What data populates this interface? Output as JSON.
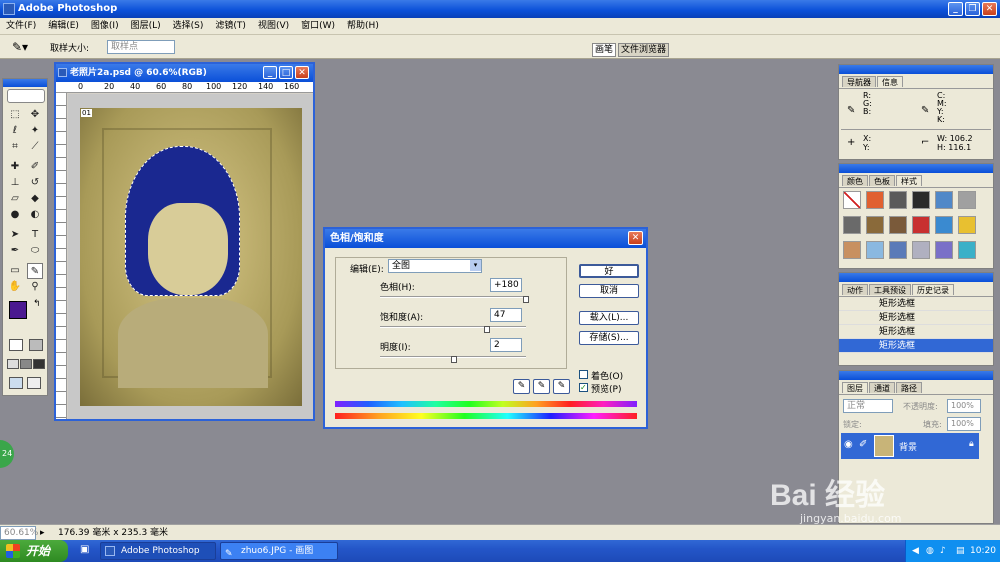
{
  "app": {
    "title": "Adobe Photoshop"
  },
  "menu": [
    "文件(F)",
    "编辑(E)",
    "图像(I)",
    "图层(L)",
    "选择(S)",
    "滤镜(T)",
    "视图(V)",
    "窗口(W)",
    "帮助(H)"
  ],
  "options": {
    "sample_size_label": "取样大小:",
    "sample_size_value": "取样点",
    "tabs": [
      "画笔",
      "文件浏览器"
    ]
  },
  "document": {
    "title": "老照片2a.psd @ 60.6%(RGB)",
    "ruler_ticks": [
      "0",
      "20",
      "40",
      "60",
      "80",
      "100",
      "120",
      "140",
      "160"
    ],
    "badge": "01"
  },
  "dialog": {
    "title": "色相/饱和度",
    "edit_label": "编辑(E):",
    "edit_value": "全图",
    "hue_label": "色相(H):",
    "hue_value": "+180",
    "saturation_label": "饱和度(A):",
    "saturation_value": "47",
    "lightness_label": "明度(I):",
    "lightness_value": "2",
    "hue_pos": 1.0,
    "saturation_pos": 0.735,
    "lightness_pos": 0.51,
    "ok": "好",
    "cancel": "取消",
    "load": "载入(L)...",
    "save": "存储(S)...",
    "colorize": "着色(O)",
    "preview": "预览(P)",
    "colorize_checked": false,
    "preview_checked": true
  },
  "navigator": {
    "tabs": [
      "导航器",
      "信息"
    ],
    "rgb_labels": [
      "R:",
      "G:",
      "B:"
    ],
    "cmyk_labels": [
      "C:",
      "M:",
      "Y:",
      "K:"
    ],
    "x_label": "X:",
    "y_label": "Y:",
    "w_label": "W:",
    "h_label": "H:",
    "w_value": "106.2",
    "h_value": "116.1"
  },
  "swatches": {
    "tabs": [
      "颜色",
      "色板",
      "样式"
    ],
    "colors": [
      "#ffffff",
      "#e06030",
      "#5a5a5a",
      "#2a2a2a",
      "#5088c8",
      "#a0a0a0",
      "#6a6a6a",
      "#8a6a3a",
      "#7a5a3a",
      "#c83030",
      "#3a8ad0",
      "#e8c030",
      "#c89060",
      "#8ab8e0",
      "#5a7ab8",
      "#b0b0c0",
      "#7a70c8",
      "#3ab0c8"
    ]
  },
  "history": {
    "tabs": [
      "动作",
      "工具预设",
      "历史记录"
    ],
    "items": [
      "矩形选框",
      "矩形选框",
      "矩形选框",
      "矩形选框"
    ]
  },
  "layers": {
    "tabs": [
      "图层",
      "通道",
      "路径"
    ],
    "blend_mode": "正常",
    "opacity_label": "不透明度:",
    "opacity_value": "100%",
    "lock_label": "锁定:",
    "fill_label": "填充:",
    "fill_value": "100%",
    "layer_name": "背景"
  },
  "status": {
    "zoom": "60.61%",
    "doc_size": "176.39 毫米 x 235.3 毫米"
  },
  "taskbar": {
    "start": "开始",
    "tasks": [
      "Adobe Photoshop",
      "zhuo6.JPG - 画图"
    ],
    "clock": "10:20"
  },
  "watermark": {
    "brand": "Bai 经验",
    "url": "jingyan.baidu.com"
  },
  "colors": {
    "foreground": "#4a1890",
    "background": "#1a1aa8",
    "accent": "#0a4fd8"
  }
}
